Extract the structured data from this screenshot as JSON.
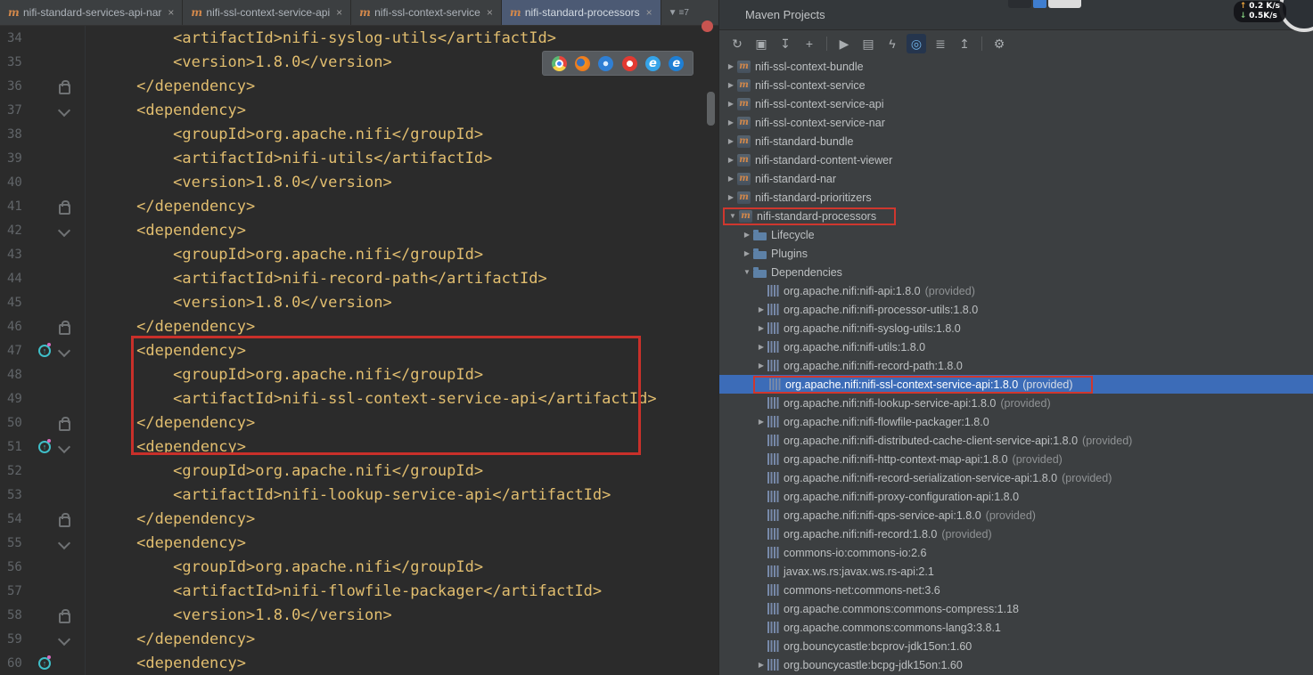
{
  "tabs": {
    "close_glyph": "×",
    "overflow": {
      "chevron": "▼",
      "label": "≡7"
    },
    "items": [
      {
        "label": "nifi-standard-services-api-nar",
        "active": false
      },
      {
        "label": "nifi-ssl-context-service-api",
        "active": false
      },
      {
        "label": "nifi-ssl-context-service",
        "active": false
      },
      {
        "label": "nifi-standard-processors",
        "active": true
      }
    ]
  },
  "editor": {
    "lines": [
      {
        "n": "34",
        "t": "         <artifactId>nifi-syslog-utils</artifactId>"
      },
      {
        "n": "35",
        "t": "         <version>1.8.0</version>"
      },
      {
        "n": "36",
        "t": "     </dependency>",
        "lock": true
      },
      {
        "n": "37",
        "t": "     <dependency>",
        "chev": true
      },
      {
        "n": "38",
        "t": "         <groupId>org.apache.nifi</groupId>"
      },
      {
        "n": "39",
        "t": "         <artifactId>nifi-utils</artifactId>"
      },
      {
        "n": "40",
        "t": "         <version>1.8.0</version>"
      },
      {
        "n": "41",
        "t": "     </dependency>",
        "lock": true
      },
      {
        "n": "42",
        "t": "     <dependency>",
        "chev": true
      },
      {
        "n": "43",
        "t": "         <groupId>org.apache.nifi</groupId>"
      },
      {
        "n": "44",
        "t": "         <artifactId>nifi-record-path</artifactId>"
      },
      {
        "n": "45",
        "t": "         <version>1.8.0</version>"
      },
      {
        "n": "46",
        "t": "     </dependency>",
        "lock": true
      },
      {
        "n": "47",
        "t": "     <dependency>",
        "chev": true,
        "badge": true
      },
      {
        "n": "48",
        "t": "         <groupId>org.apache.nifi</groupId>"
      },
      {
        "n": "49",
        "t": "         <artifactId>nifi-ssl-context-service-api</artifactId>"
      },
      {
        "n": "50",
        "t": "     </dependency>",
        "lock": true
      },
      {
        "n": "51",
        "t": "     <dependency>",
        "chev": true,
        "badge": true
      },
      {
        "n": "52",
        "t": "         <groupId>org.apache.nifi</groupId>"
      },
      {
        "n": "53",
        "t": "         <artifactId>nifi-lookup-service-api</artifactId>"
      },
      {
        "n": "54",
        "t": "     </dependency>",
        "lock": true
      },
      {
        "n": "55",
        "t": "     <dependency>",
        "chev": true
      },
      {
        "n": "56",
        "t": "         <groupId>org.apache.nifi</groupId>"
      },
      {
        "n": "57",
        "t": "         <artifactId>nifi-flowfile-packager</artifactId>"
      },
      {
        "n": "58",
        "t": "         <version>1.8.0</version>",
        "lock": true
      },
      {
        "n": "59",
        "t": "     </dependency>",
        "chev": true
      },
      {
        "n": "60",
        "t": "     <dependency>",
        "badge": true
      }
    ]
  },
  "browser_icons": [
    "chrome-icon",
    "firefox-icon",
    "safari-icon",
    "opera-icon",
    "ie-icon",
    "edge-icon"
  ],
  "maven": {
    "title": "Maven Projects",
    "toolbar": [
      {
        "name": "reimport-all-maven-projects-icon",
        "glyph": "↻"
      },
      {
        "name": "update-folders-icon",
        "glyph": "▣"
      },
      {
        "name": "download-sources-icon",
        "glyph": "↧"
      },
      {
        "name": "add-maven-project-icon",
        "glyph": "+"
      },
      {
        "name": "toolbar-divider",
        "glyph": "",
        "divider": true
      },
      {
        "name": "execute-maven-goal-icon",
        "glyph": "▶"
      },
      {
        "name": "profiles-icon",
        "glyph": "▤"
      },
      {
        "name": "toggle-offline-icon",
        "glyph": "ϟ"
      },
      {
        "name": "skip-tests-icon",
        "glyph": "◎",
        "pressed": true
      },
      {
        "name": "show-dependencies-icon",
        "glyph": "≣"
      },
      {
        "name": "collapse-all-icon",
        "glyph": "↥"
      },
      {
        "name": "toolbar-divider",
        "glyph": "",
        "divider": true
      },
      {
        "name": "maven-settings-icon",
        "glyph": "⚙"
      }
    ],
    "tree": [
      {
        "indent": 0,
        "arrow": "▶",
        "icon": "maven",
        "label": "nifi-ssl-context-bundle"
      },
      {
        "indent": 0,
        "arrow": "▶",
        "icon": "maven",
        "label": "nifi-ssl-context-service"
      },
      {
        "indent": 0,
        "arrow": "▶",
        "icon": "maven",
        "label": "nifi-ssl-context-service-api"
      },
      {
        "indent": 0,
        "arrow": "▶",
        "icon": "maven",
        "label": "nifi-ssl-context-service-nar"
      },
      {
        "indent": 0,
        "arrow": "▶",
        "icon": "maven",
        "label": "nifi-standard-bundle"
      },
      {
        "indent": 0,
        "arrow": "▶",
        "icon": "maven",
        "label": "nifi-standard-content-viewer"
      },
      {
        "indent": 0,
        "arrow": "▶",
        "icon": "maven",
        "label": "nifi-standard-nar"
      },
      {
        "indent": 0,
        "arrow": "▶",
        "icon": "maven",
        "label": "nifi-standard-prioritizers"
      },
      {
        "indent": 0,
        "arrow": "▼",
        "icon": "maven",
        "label": "nifi-standard-processors",
        "boxed": true
      },
      {
        "indent": 1,
        "arrow": "▶",
        "icon": "folder",
        "label": "Lifecycle"
      },
      {
        "indent": 1,
        "arrow": "▶",
        "icon": "folder",
        "label": "Plugins"
      },
      {
        "indent": 1,
        "arrow": "▼",
        "icon": "folder",
        "label": "Dependencies"
      },
      {
        "indent": 2,
        "arrow": "",
        "icon": "lib",
        "label": "org.apache.nifi:nifi-api:1.8.0",
        "meta": "(provided)"
      },
      {
        "indent": 2,
        "arrow": "▶",
        "icon": "lib",
        "label": "org.apache.nifi:nifi-processor-utils:1.8.0"
      },
      {
        "indent": 2,
        "arrow": "▶",
        "icon": "lib",
        "label": "org.apache.nifi:nifi-syslog-utils:1.8.0"
      },
      {
        "indent": 2,
        "arrow": "▶",
        "icon": "lib",
        "label": "org.apache.nifi:nifi-utils:1.8.0"
      },
      {
        "indent": 2,
        "arrow": "▶",
        "icon": "lib",
        "label": "org.apache.nifi:nifi-record-path:1.8.0"
      },
      {
        "indent": 2,
        "arrow": "",
        "icon": "lib",
        "label": "org.apache.nifi:nifi-ssl-context-service-api:1.8.0",
        "meta": "(provided)",
        "selected": true,
        "boxed": true
      },
      {
        "indent": 2,
        "arrow": "",
        "icon": "lib",
        "label": "org.apache.nifi:nifi-lookup-service-api:1.8.0",
        "meta": "(provided)"
      },
      {
        "indent": 2,
        "arrow": "▶",
        "icon": "lib",
        "label": "org.apache.nifi:nifi-flowfile-packager:1.8.0"
      },
      {
        "indent": 2,
        "arrow": "",
        "icon": "lib",
        "label": "org.apache.nifi:nifi-distributed-cache-client-service-api:1.8.0",
        "meta": "(provided)"
      },
      {
        "indent": 2,
        "arrow": "",
        "icon": "lib",
        "label": "org.apache.nifi:nifi-http-context-map-api:1.8.0",
        "meta": "(provided)"
      },
      {
        "indent": 2,
        "arrow": "",
        "icon": "lib",
        "label": "org.apache.nifi:nifi-record-serialization-service-api:1.8.0",
        "meta": "(provided)"
      },
      {
        "indent": 2,
        "arrow": "",
        "icon": "lib",
        "label": "org.apache.nifi:nifi-proxy-configuration-api:1.8.0"
      },
      {
        "indent": 2,
        "arrow": "",
        "icon": "lib",
        "label": "org.apache.nifi:nifi-qps-service-api:1.8.0",
        "meta": "(provided)"
      },
      {
        "indent": 2,
        "arrow": "",
        "icon": "lib",
        "label": "org.apache.nifi:nifi-record:1.8.0",
        "meta": "(provided)"
      },
      {
        "indent": 2,
        "arrow": "",
        "icon": "lib",
        "label": "commons-io:commons-io:2.6"
      },
      {
        "indent": 2,
        "arrow": "",
        "icon": "lib",
        "label": "javax.ws.rs:javax.ws.rs-api:2.1"
      },
      {
        "indent": 2,
        "arrow": "",
        "icon": "lib",
        "label": "commons-net:commons-net:3.6"
      },
      {
        "indent": 2,
        "arrow": "",
        "icon": "lib",
        "label": "org.apache.commons:commons-compress:1.18"
      },
      {
        "indent": 2,
        "arrow": "",
        "icon": "lib",
        "label": "org.apache.commons:commons-lang3:3.8.1"
      },
      {
        "indent": 2,
        "arrow": "",
        "icon": "lib",
        "label": "org.bouncycastle:bcprov-jdk15on:1.60"
      },
      {
        "indent": 2,
        "arrow": "▶",
        "icon": "lib",
        "label": "org.bouncycastle:bcpg-jdk15on:1.60"
      }
    ]
  },
  "network": {
    "up_arrow": "↑",
    "up_value": "0.2 K/s",
    "down_arrow": "↓",
    "down_value": "0.5K/s"
  }
}
